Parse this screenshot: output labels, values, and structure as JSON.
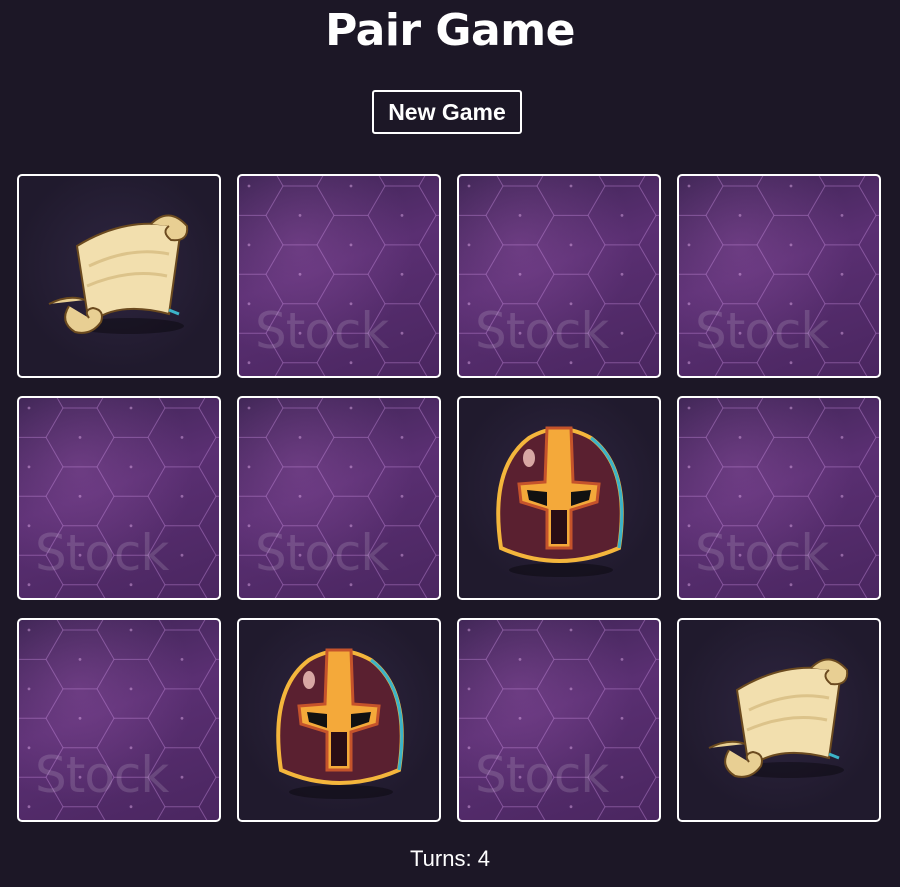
{
  "header": {
    "title": "Pair Game",
    "new_game_label": "New Game"
  },
  "board": {
    "cards": [
      {
        "state": "face",
        "icon": "scroll-icon"
      },
      {
        "state": "back",
        "watermark": "Stock"
      },
      {
        "state": "back",
        "watermark": "Stock"
      },
      {
        "state": "back",
        "watermark": "Stock"
      },
      {
        "state": "back",
        "watermark": "Stock"
      },
      {
        "state": "back",
        "watermark": "Stock"
      },
      {
        "state": "face",
        "icon": "helmet-icon"
      },
      {
        "state": "back",
        "watermark": "Stock"
      },
      {
        "state": "back",
        "watermark": "Stock"
      },
      {
        "state": "face",
        "icon": "helmet-icon"
      },
      {
        "state": "back",
        "watermark": "Stock"
      },
      {
        "state": "face",
        "icon": "scroll-icon"
      }
    ]
  },
  "footer": {
    "turns_text": "Turns: 4"
  },
  "colors": {
    "background": "#1c1726",
    "card_back": "#5a2f72",
    "border": "#ffffff"
  }
}
